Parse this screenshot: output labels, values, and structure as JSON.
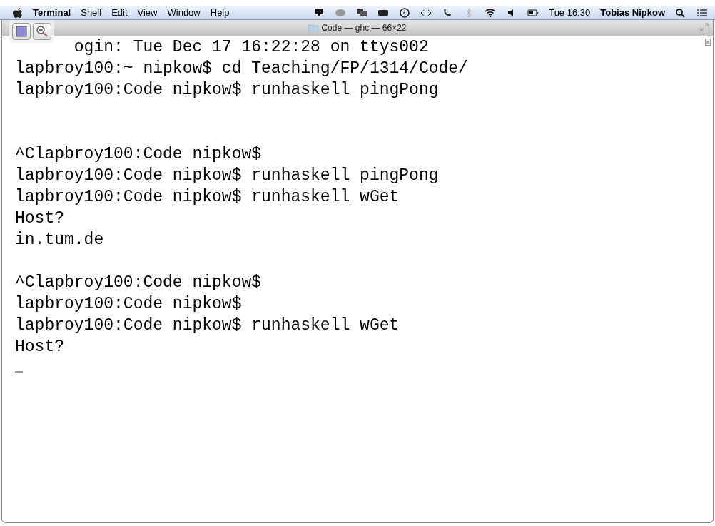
{
  "menu_bar": {
    "app_name": "Terminal",
    "menus": [
      "Shell",
      "Edit",
      "View",
      "Window",
      "Help"
    ],
    "clock": "Tue 16:30",
    "user": "Tobias Nipkow"
  },
  "window": {
    "title": "Code — ghc — 66×22"
  },
  "terminal": {
    "lines": [
      {
        "kind": "partial",
        "text": "ogin: Tue Dec 17 16:22:28 on ttys002"
      },
      {
        "kind": "text",
        "text": "lapbroy100:~ nipkow$ cd Teaching/FP/1314/Code/"
      },
      {
        "kind": "text",
        "text": "lapbroy100:Code nipkow$ runhaskell pingPong"
      },
      {
        "kind": "blank"
      },
      {
        "kind": "blank"
      },
      {
        "kind": "text",
        "text": "^Clapbroy100:Code nipkow$"
      },
      {
        "kind": "text",
        "text": "lapbroy100:Code nipkow$ runhaskell pingPong"
      },
      {
        "kind": "text",
        "text": "lapbroy100:Code nipkow$ runhaskell wGet"
      },
      {
        "kind": "text",
        "text": "Host?"
      },
      {
        "kind": "text",
        "text": "in.tum.de"
      },
      {
        "kind": "blank"
      },
      {
        "kind": "text",
        "text": "^Clapbroy100:Code nipkow$"
      },
      {
        "kind": "text",
        "text": "lapbroy100:Code nipkow$"
      },
      {
        "kind": "text",
        "text": "lapbroy100:Code nipkow$ runhaskell wGet"
      },
      {
        "kind": "text",
        "text": "Host?"
      },
      {
        "kind": "cursor"
      }
    ]
  }
}
